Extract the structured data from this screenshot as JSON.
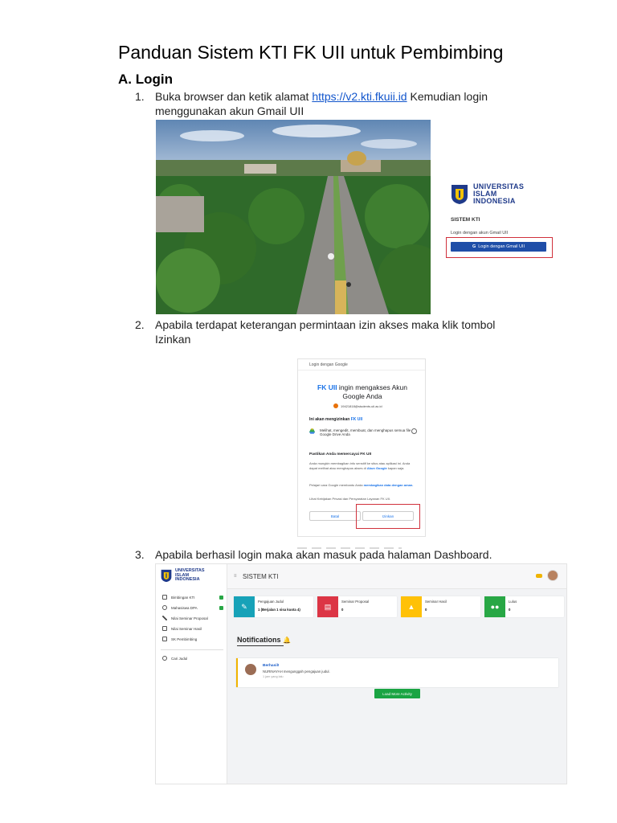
{
  "doc": {
    "title": "Panduan Sistem KTI FK UII untuk Pembimbing",
    "section": "A. Login"
  },
  "steps": [
    {
      "number": "1.",
      "text_before": "Buka browser dan ketik alamat ",
      "link": "https://v2.kti.fkuii.id",
      "text_after": " Kemudian login menggunakan akun Gmail UII"
    },
    {
      "number": "2.",
      "text": "Apabila terdapat keterangan permintaan izin akses maka klik tombol Izinkan"
    },
    {
      "number": "3.",
      "text": "Apabila berhasil login maka akan masuk pada halaman Dashboard."
    }
  ],
  "uii_login": {
    "logo_lines": [
      "UNIVERSITAS",
      "ISLAM",
      "INDONESIA"
    ],
    "system": "SISTEM KTI",
    "subtitle": "Login dengan akun Gmail UII",
    "button": "Login dengan Gmail UII",
    "colors": {
      "brand": "#1f3a8a",
      "button": "#1f4ea8",
      "highlight": "#d0313c"
    }
  },
  "google_consent": {
    "topbar": "Login dengan Google",
    "app_name": "FK UII",
    "heading_rest": " ingin mengakses Akun Google Anda",
    "email": "19421818@students.uii.ac.id",
    "allow_title_prefix": "Ini akan mengizinkan ",
    "permission": "Melihat, mengedit, membuat, dan menghapus semua file Google Drive Anda",
    "trust_title": "Pastikan Anda memercayai FK UII",
    "trust_p1_before": "Anda mungkin membagikan info sensitif ke situs atau aplikasi ini. Anda dapat melihat atau menghapus akses di ",
    "trust_p1_link": "Akun Google",
    "trust_p1_after": " kapan saja.",
    "trust_p2_before": "Pelajari cara Google membantu Anda ",
    "trust_p2_link": "membagikan data dengan aman.",
    "trust_p3": "Lihat Kebijakan Privasi dan Persyaratan Layanan FK UII.",
    "cancel": "Batal",
    "allow": "Izinkan"
  },
  "dashboard": {
    "logo_lines": [
      "UNIVERSITAS",
      "ISLAM",
      "INDONESIA"
    ],
    "header_title": "SISTEM KTI",
    "menu": [
      {
        "label": "Bimbingan KTI",
        "icon": "book-icon",
        "badge": true
      },
      {
        "label": "Mahasiswa DPA",
        "icon": "user-icon",
        "badge": true
      },
      {
        "label": "Nilai Seminar Proposal",
        "icon": "pencil-icon",
        "badge": false
      },
      {
        "label": "Nilai Seminar Hasil",
        "icon": "edit-icon",
        "badge": false
      },
      {
        "label": "SK Pembimbing",
        "icon": "copy-icon",
        "badge": false
      }
    ],
    "search_label": "Cari Judul",
    "cards": [
      {
        "label": "Pengajuan Judul",
        "value": "1 (Berjalan 1 sisa kuota 4)",
        "color": "#17a2b8",
        "icon": "pencil-icon"
      },
      {
        "label": "Seminar Proposal",
        "value": "0",
        "color": "#dc3545",
        "icon": "file-icon"
      },
      {
        "label": "Seminar Hasil",
        "value": "0",
        "color": "#ffc107",
        "icon": "graduation-cap-icon"
      },
      {
        "label": "Lulus",
        "value": "0",
        "color": "#28a745",
        "icon": "users-icon"
      }
    ],
    "notifications_title": "Notifications",
    "activity": {
      "title": "Berhasil!",
      "desc": "NURINAYAH mengunggah pengajuan judul.",
      "time": "1 jam yang lalu"
    },
    "load_more": "Load More Activity"
  }
}
